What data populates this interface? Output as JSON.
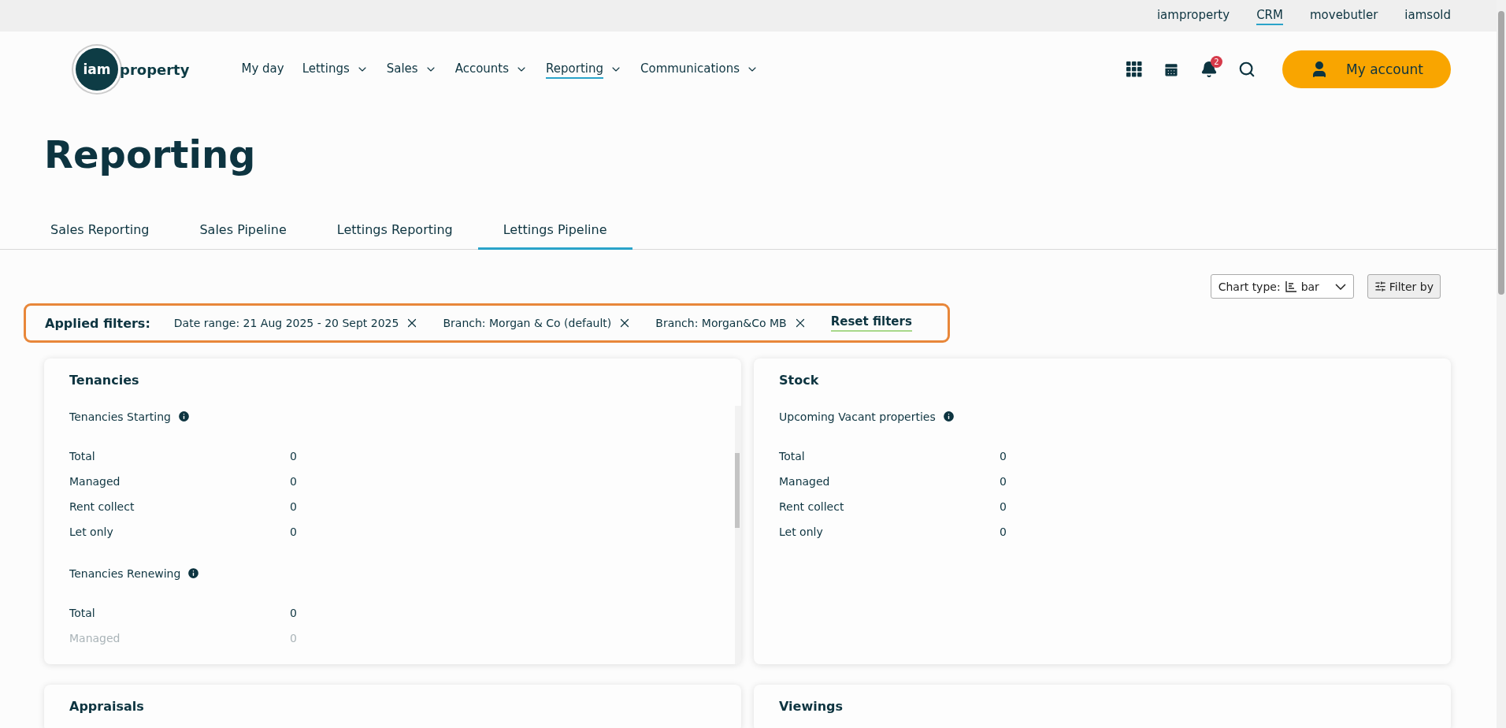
{
  "top_links": [
    {
      "label": "iamproperty",
      "selected": false
    },
    {
      "label": "CRM",
      "selected": true
    },
    {
      "label": "movebutler",
      "selected": false
    },
    {
      "label": "iamsold",
      "selected": false
    }
  ],
  "logo": {
    "badge": "iam",
    "word": "property"
  },
  "nav": [
    {
      "label": "My day",
      "dropdown": false,
      "selected": false
    },
    {
      "label": "Lettings",
      "dropdown": true,
      "selected": false
    },
    {
      "label": "Sales",
      "dropdown": true,
      "selected": false
    },
    {
      "label": "Accounts",
      "dropdown": true,
      "selected": false
    },
    {
      "label": "Reporting",
      "dropdown": true,
      "selected": true
    },
    {
      "label": "Communications",
      "dropdown": true,
      "selected": false
    }
  ],
  "notification_count": "2",
  "account_button": "My account",
  "page_title": "Reporting",
  "tabs": [
    {
      "label": "Sales Reporting",
      "selected": false
    },
    {
      "label": "Sales Pipeline",
      "selected": false
    },
    {
      "label": "Lettings Reporting",
      "selected": false
    },
    {
      "label": "Lettings Pipeline",
      "selected": true
    }
  ],
  "chart_type": {
    "label": "Chart type:",
    "value": "bar"
  },
  "filter_button": "Filter by",
  "applied_filters": {
    "label": "Applied filters:",
    "items": [
      "Date range: 21 Aug 2025 - 20 Sept 2025",
      "Branch: Morgan & Co (default)",
      "Branch: Morgan&Co MB"
    ],
    "reset": "Reset filters"
  },
  "cards": [
    {
      "title": "Tenancies",
      "scrollable": true,
      "sections": [
        {
          "title": "Tenancies Starting",
          "rows": [
            {
              "label": "Total",
              "value": "0",
              "faded": false
            },
            {
              "label": "Managed",
              "value": "0",
              "faded": false
            },
            {
              "label": "Rent collect",
              "value": "0",
              "faded": false
            },
            {
              "label": "Let only",
              "value": "0",
              "faded": false
            }
          ]
        },
        {
          "title": "Tenancies Renewing",
          "rows": [
            {
              "label": "Total",
              "value": "0",
              "faded": false
            },
            {
              "label": "Managed",
              "value": "0",
              "faded": true
            }
          ]
        }
      ]
    },
    {
      "title": "Stock",
      "scrollable": false,
      "sections": [
        {
          "title": "Upcoming Vacant properties",
          "rows": [
            {
              "label": "Total",
              "value": "0",
              "faded": false
            },
            {
              "label": "Managed",
              "value": "0",
              "faded": false
            },
            {
              "label": "Rent collect",
              "value": "0",
              "faded": false
            },
            {
              "label": "Let only",
              "value": "0",
              "faded": false
            }
          ]
        }
      ]
    },
    {
      "title": "Appraisals"
    },
    {
      "title": "Viewings"
    }
  ]
}
